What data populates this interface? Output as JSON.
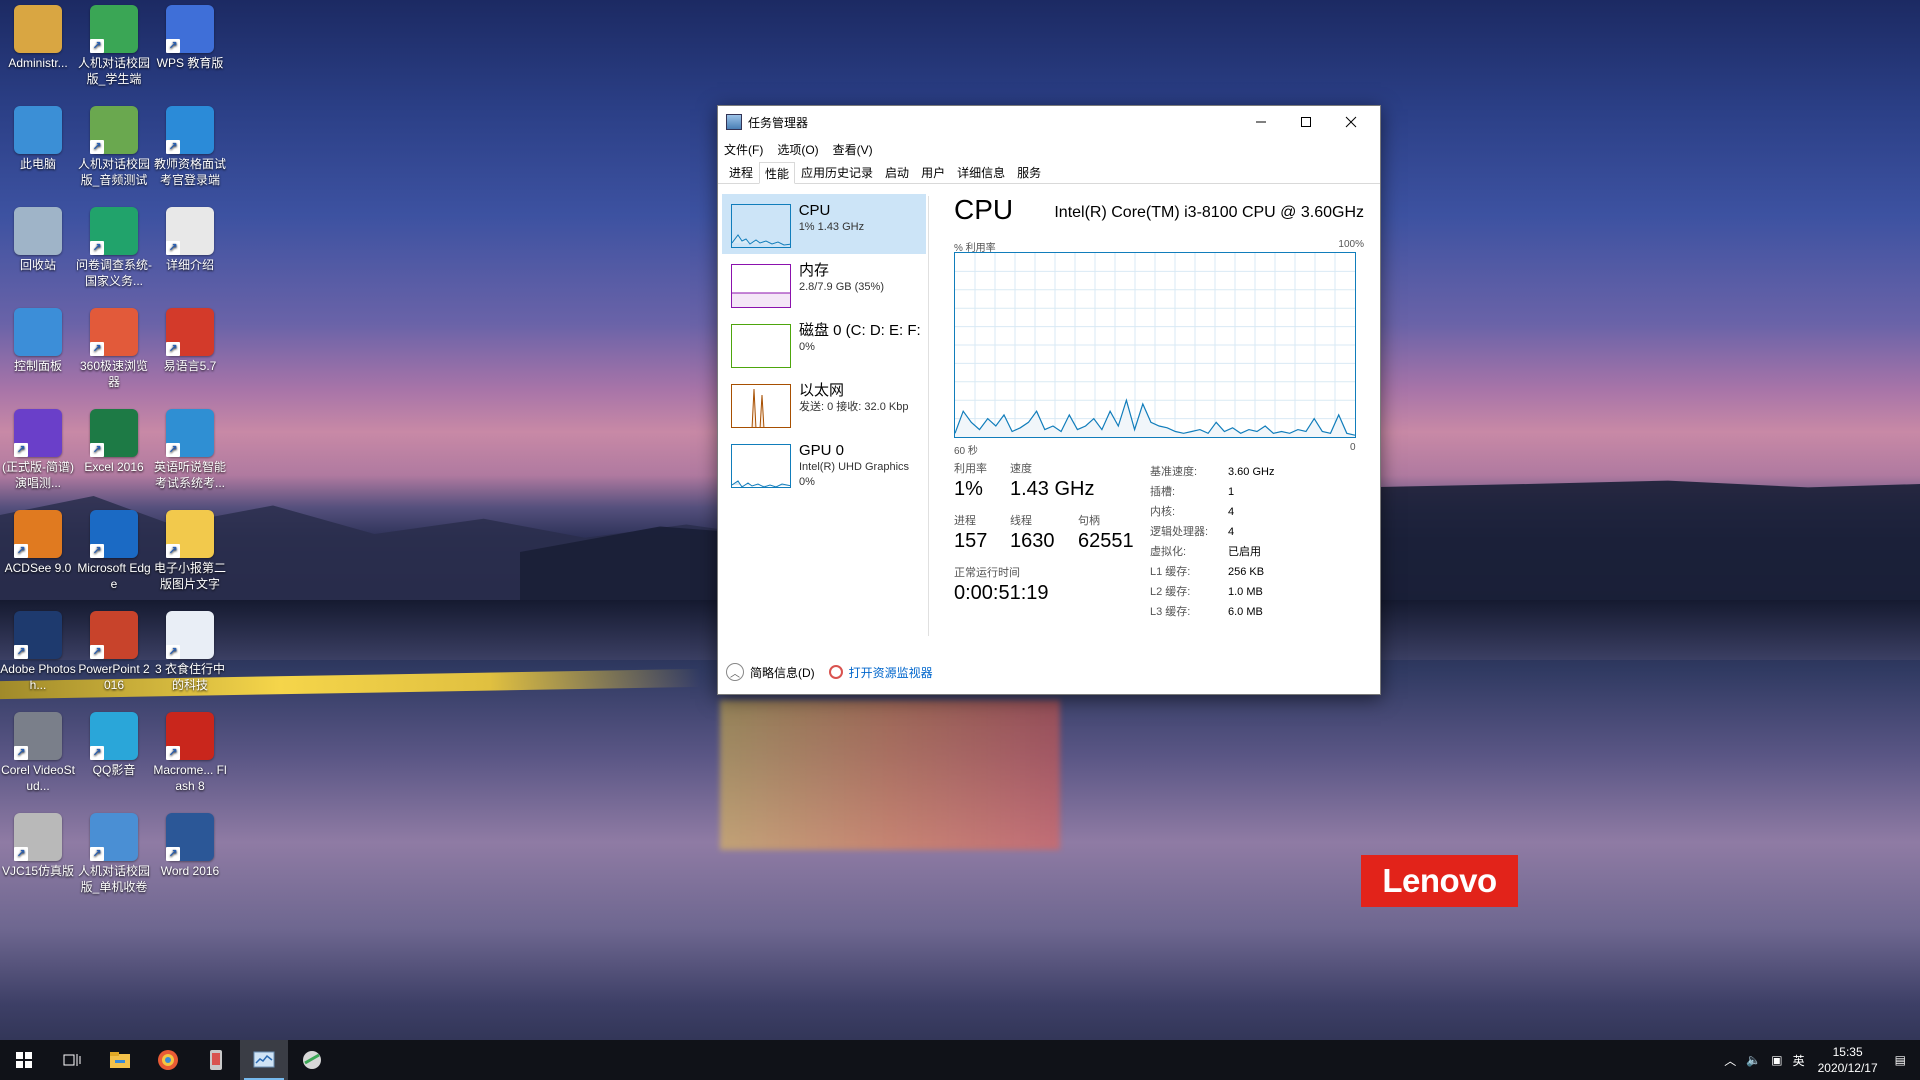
{
  "desktop": {
    "icons": [
      {
        "label": "Administr...",
        "icon": "user-folder-icon",
        "color": "#d9a642"
      },
      {
        "label": "人机对话校园版_学生端",
        "icon": "app-green-icon",
        "color": "#3aa655"
      },
      {
        "label": "WPS 教育版",
        "icon": "wps-icon",
        "color": "#3f6fd8"
      },
      {
        "label": "此电脑",
        "icon": "computer-icon",
        "color": "#3b8fd6"
      },
      {
        "label": "人机对话校园版_音频测试",
        "icon": "app-green-icon",
        "color": "#6aa84f"
      },
      {
        "label": "教师资格面试考官登录端",
        "icon": "ie-icon",
        "color": "#2b8bd8"
      },
      {
        "label": "回收站",
        "icon": "recycle-bin-icon",
        "color": "#9fb4c8"
      },
      {
        "label": "问卷调查系统-国家义务...",
        "icon": "survey-icon",
        "color": "#21a36b"
      },
      {
        "label": "详细介绍",
        "icon": "text-file-icon",
        "color": "#e8e8e8"
      },
      {
        "label": "控制面板",
        "icon": "control-panel-icon",
        "color": "#3c8ed8"
      },
      {
        "label": "360极速浏览器",
        "icon": "360-browser-icon",
        "color": "#e25a3a"
      },
      {
        "label": "易语言5.7",
        "icon": "yi-language-icon",
        "color": "#d33a2a"
      },
      {
        "label": "(正式版-简谱)演唱测...",
        "icon": "music-icon",
        "color": "#6a3fc9"
      },
      {
        "label": "Excel 2016",
        "icon": "excel-icon",
        "color": "#1d7a45"
      },
      {
        "label": "英语听说智能考试系统考...",
        "icon": "english-exam-icon",
        "color": "#2f8fd3"
      },
      {
        "label": "ACDSee 9.0",
        "icon": "acdsee-icon",
        "color": "#e07a20"
      },
      {
        "label": "Microsoft Edge",
        "icon": "edge-icon",
        "color": "#1b6ac4"
      },
      {
        "label": "电子小报第二版图片文字",
        "icon": "folder-icon",
        "color": "#f2c94c"
      },
      {
        "label": "Adobe Photosh...",
        "icon": "photoshop-icon",
        "color": "#1e3a6e"
      },
      {
        "label": "PowerPoint 2016",
        "icon": "powerpoint-icon",
        "color": "#c8432b"
      },
      {
        "label": "3 衣食住行中的科技",
        "icon": "word-doc-icon",
        "color": "#e9eef6"
      },
      {
        "label": "Corel VideoStud...",
        "icon": "corel-icon",
        "color": "#7a7f8a"
      },
      {
        "label": "QQ影音",
        "icon": "qq-player-icon",
        "color": "#2aa6d9"
      },
      {
        "label": "Macrome... Flash 8",
        "icon": "flash-icon",
        "color": "#c9261c"
      },
      {
        "label": "VJC15仿真版",
        "icon": "robot-icon",
        "color": "#b9b9b9"
      },
      {
        "label": "人机对话校园版_单机收卷",
        "icon": "exam-icon",
        "color": "#4a8fd4"
      },
      {
        "label": "Word 2016",
        "icon": "word-icon",
        "color": "#2b5797"
      }
    ]
  },
  "brand": {
    "text": "Lenovo",
    "color": "#e2231a"
  },
  "taskmgr": {
    "title": "任务管理器",
    "menu": [
      "文件(F)",
      "选项(O)",
      "查看(V)"
    ],
    "tabs": [
      "进程",
      "性能",
      "应用历史记录",
      "启动",
      "用户",
      "详细信息",
      "服务"
    ],
    "active_tab": "性能",
    "sidebar": [
      {
        "name": "CPU",
        "sub": "1% 1.43 GHz",
        "color": "#117dbb"
      },
      {
        "name": "内存",
        "sub": "2.8/7.9 GB (35%)",
        "color": "#8b12ae"
      },
      {
        "name": "磁盘 0 (C: D: E: F:",
        "sub": "0%",
        "color": "#4da60c"
      },
      {
        "name": "以太网",
        "sub": "发送: 0 接收: 32.0 Kbp",
        "color": "#a74f01"
      },
      {
        "name": "GPU 0",
        "sub": "Intel(R) UHD Graphics",
        "sub2": "0%",
        "color": "#117dbb"
      }
    ],
    "cpu": {
      "heading": "CPU",
      "model": "Intel(R) Core(TM) i3-8100 CPU @ 3.60GHz",
      "axis_util": "% 利用率",
      "axis_max": "100%",
      "axis_time": "60 秒",
      "axis_zero": "0",
      "utilization_label": "利用率",
      "utilization_value": "1%",
      "speed_label": "速度",
      "speed_value": "1.43 GHz",
      "processes_label": "进程",
      "processes_value": "157",
      "threads_label": "线程",
      "threads_value": "1630",
      "handles_label": "句柄",
      "handles_value": "62551",
      "uptime_label": "正常运行时间",
      "uptime_value": "0:00:51:19",
      "props": [
        {
          "k": "基准速度:",
          "v": "3.60 GHz"
        },
        {
          "k": "插槽:",
          "v": "1"
        },
        {
          "k": "内核:",
          "v": "4"
        },
        {
          "k": "逻辑处理器:",
          "v": "4"
        },
        {
          "k": "虚拟化:",
          "v": "已启用"
        },
        {
          "k": "L1 缓存:",
          "v": "256 KB"
        },
        {
          "k": "L2 缓存:",
          "v": "1.0 MB"
        },
        {
          "k": "L3 缓存:",
          "v": "6.0 MB"
        }
      ]
    },
    "footer": {
      "less_details": "简略信息(D)",
      "resource_monitor": "打开资源监视器"
    }
  },
  "taskbar": {
    "time": "15:35",
    "date": "2020/12/17",
    "ime": "英",
    "pinned": [
      "start-icon",
      "task-view-icon",
      "file-explorer-icon",
      "360-browser-icon",
      "phone-icon",
      "task-manager-icon",
      "app-icon"
    ]
  },
  "cpu_series": [
    2,
    14,
    8,
    4,
    10,
    6,
    12,
    3,
    5,
    8,
    14,
    4,
    6,
    3,
    12,
    4,
    6,
    10,
    4,
    14,
    6,
    20,
    4,
    18,
    8,
    6,
    5,
    3,
    2,
    3,
    4,
    2,
    8,
    3,
    5,
    2,
    4,
    3,
    6,
    2,
    3,
    2,
    4,
    3,
    10,
    3,
    2,
    12,
    2,
    1
  ]
}
